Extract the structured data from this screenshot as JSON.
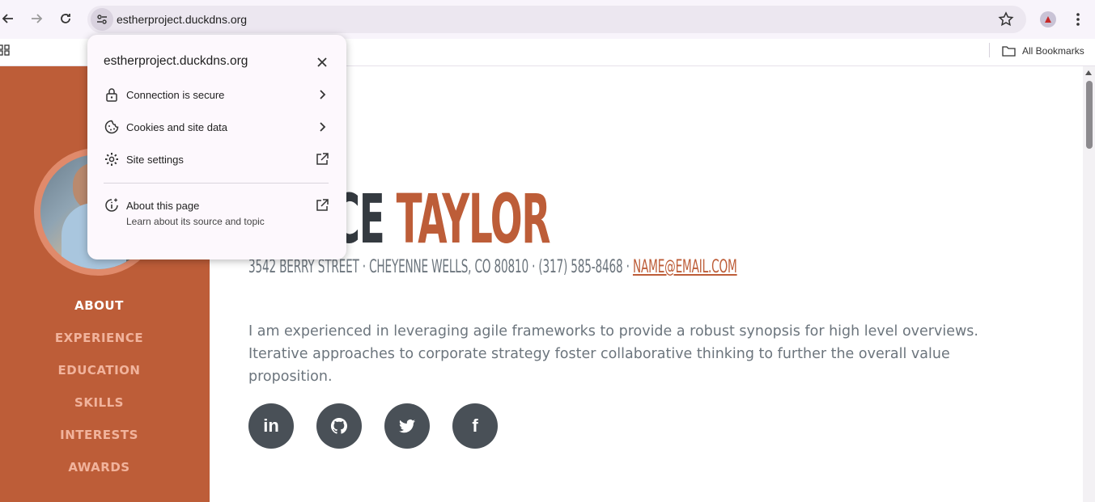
{
  "browser": {
    "url": "estherproject.duckdns.org",
    "all_bookmarks_label": "All Bookmarks"
  },
  "site_info_popup": {
    "title": "estherproject.duckdns.org",
    "rows": [
      {
        "label": "Connection is secure",
        "icon": "lock-icon"
      },
      {
        "label": "Cookies and site data",
        "icon": "cookie-icon"
      },
      {
        "label": "Site settings",
        "icon": "gear-icon"
      }
    ],
    "about": {
      "label": "About this page",
      "sublabel": "Learn about its source and topic"
    }
  },
  "sidebar": {
    "nav": [
      {
        "label": "ABOUT",
        "active": true
      },
      {
        "label": "EXPERIENCE"
      },
      {
        "label": "EDUCATION"
      },
      {
        "label": "SKILLS"
      },
      {
        "label": "INTERESTS"
      },
      {
        "label": "AWARDS"
      }
    ]
  },
  "main": {
    "name_first_visible": "RENCE",
    "name_last": "TAYLOR",
    "address": "3542 BERRY STREET · CHEYENNE WELLS, CO 80810 · (317) 585-8468 · ",
    "email": "NAME@EMAIL.COM",
    "bio": "I am experienced in leveraging agile frameworks to provide a robust synopsis for high level overviews. Iterative approaches to corporate strategy foster collaborative thinking to further the overall value proposition.",
    "socials": [
      {
        "name": "linkedin-icon",
        "glyph": "in"
      },
      {
        "name": "github-icon",
        "glyph": ""
      },
      {
        "name": "twitter-icon",
        "glyph": ""
      },
      {
        "name": "facebook-icon",
        "glyph": "f"
      }
    ]
  },
  "colors": {
    "primary": "#bd5d38",
    "dark": "#343a40",
    "muted": "#6c757d",
    "social_bg": "#495057"
  }
}
